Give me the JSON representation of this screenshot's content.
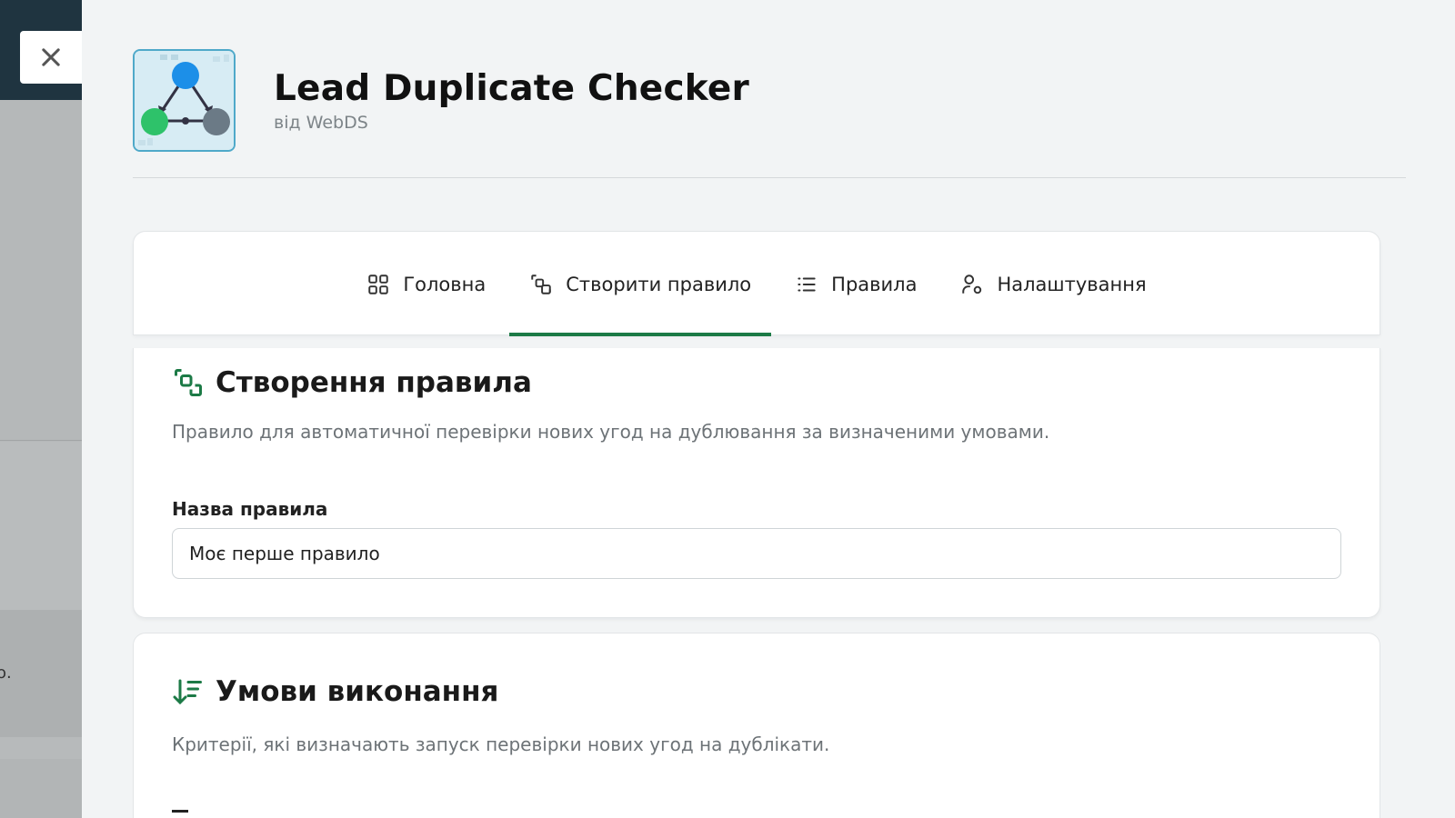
{
  "backdrop": {
    "fragment_text": "о."
  },
  "app": {
    "title": "Lead Duplicate Checker",
    "publisher": "від WebDS",
    "logo_icon": "network-graph-logo"
  },
  "tabs": [
    {
      "label": "Головна",
      "icon": "grid-icon",
      "active": false
    },
    {
      "label": "Створити правило",
      "icon": "shapes-link-icon",
      "active": true
    },
    {
      "label": "Правила",
      "icon": "list-icon",
      "active": false
    },
    {
      "label": "Налаштування",
      "icon": "user-gear-icon",
      "active": false
    }
  ],
  "rule_section": {
    "title": "Створення правила",
    "description": "Правило для автоматичної перевірки нових угод на дублювання за визначеними умовами.",
    "name_label": "Назва правила",
    "name_value": "Моє перше правило"
  },
  "conditions_section": {
    "title": "Умови виконання",
    "description": "Критерії, які визначають запуск перевірки нових угод на дублікати."
  },
  "colors": {
    "accent": "#1c7a46",
    "scrollbar": "#4d9e74",
    "sidebar_dark": "#1f3440"
  }
}
